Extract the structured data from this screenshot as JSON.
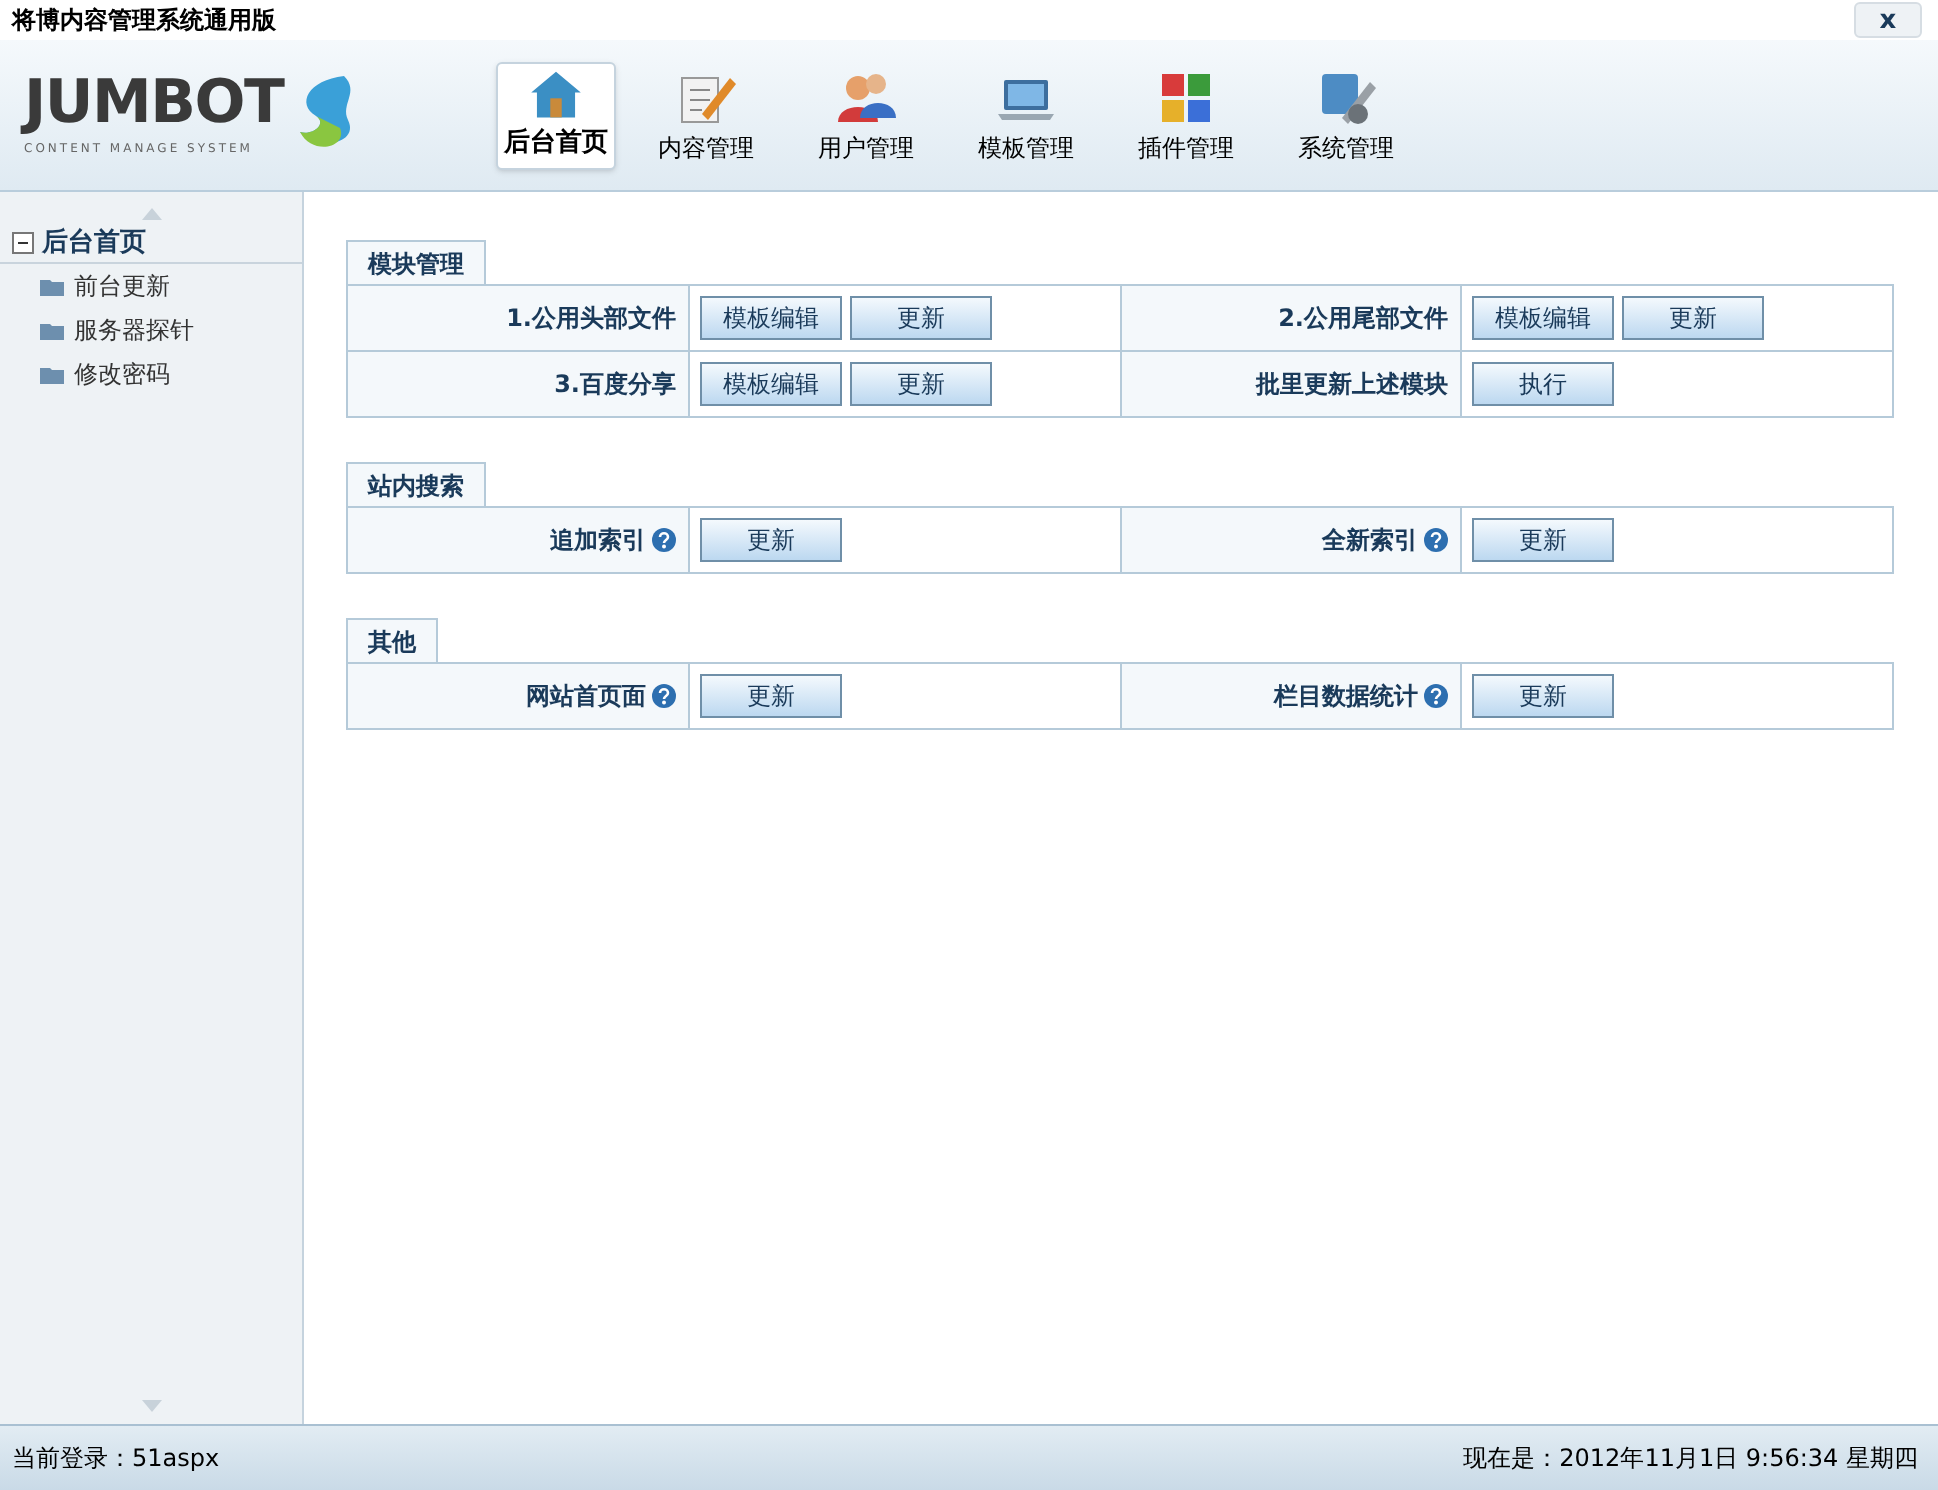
{
  "window": {
    "title": "将博内容管理系统通用版",
    "close": "x"
  },
  "logo": {
    "name": "JUMBOT",
    "tagline": "CONTENT MANAGE SYSTEM"
  },
  "nav": [
    {
      "label": "后台首页",
      "selected": true
    },
    {
      "label": "内容管理",
      "selected": false
    },
    {
      "label": "用户管理",
      "selected": false
    },
    {
      "label": "模板管理",
      "selected": false
    },
    {
      "label": "插件管理",
      "selected": false
    },
    {
      "label": "系统管理",
      "selected": false
    }
  ],
  "sidebar": {
    "items": [
      {
        "label": "后台首页",
        "expanded": true,
        "children": [
          {
            "label": "前台更新"
          },
          {
            "label": "服务器探针"
          },
          {
            "label": "修改密码"
          }
        ]
      }
    ]
  },
  "sections": [
    {
      "title": "模块管理",
      "rows": [
        {
          "cells": [
            {
              "label": "1.公用头部文件",
              "help": false,
              "buttons": [
                "模板编辑",
                "更新"
              ]
            },
            {
              "label": "2.公用尾部文件",
              "help": false,
              "buttons": [
                "模板编辑",
                "更新"
              ]
            }
          ]
        },
        {
          "cells": [
            {
              "label": "3.百度分享",
              "help": false,
              "buttons": [
                "模板编辑",
                "更新"
              ]
            },
            {
              "label": "批里更新上述模块",
              "help": false,
              "buttons": [
                "执行"
              ]
            }
          ]
        }
      ]
    },
    {
      "title": "站内搜索",
      "rows": [
        {
          "cells": [
            {
              "label": "追加索引",
              "help": true,
              "buttons": [
                "更新"
              ]
            },
            {
              "label": "全新索引",
              "help": true,
              "buttons": [
                "更新"
              ]
            }
          ]
        }
      ]
    },
    {
      "title": "其他",
      "rows": [
        {
          "cells": [
            {
              "label": "网站首页面",
              "help": true,
              "buttons": [
                "更新"
              ]
            },
            {
              "label": "栏目数据统计",
              "help": true,
              "buttons": [
                "更新"
              ]
            }
          ]
        }
      ]
    }
  ],
  "status_bar": {
    "login": "当前登录：51aspx",
    "time": "现在是：2012年11月1日 9:56:34 星期四"
  }
}
